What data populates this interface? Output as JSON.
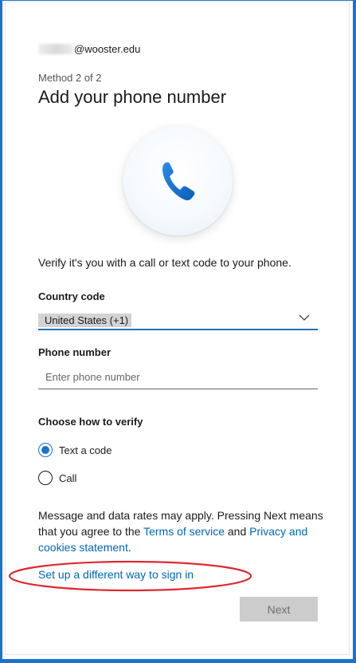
{
  "account": {
    "email_suffix": "@wooster.edu"
  },
  "header": {
    "step": "Method 2 of 2",
    "title": "Add your phone number"
  },
  "description": "Verify it's you with a call or text code to your phone.",
  "country": {
    "label": "Country code",
    "selected": "United States (+1)"
  },
  "phone": {
    "label": "Phone number",
    "placeholder": "Enter phone number",
    "value": ""
  },
  "verify": {
    "label": "Choose how to verify",
    "options": [
      {
        "label": "Text a code",
        "selected": true
      },
      {
        "label": "Call",
        "selected": false
      }
    ]
  },
  "notice": {
    "text_before": "Message and data rates may apply. Pressing Next means that you agree to the ",
    "terms_link": "Terms of service",
    "text_middle": " and ",
    "privacy_link": "Privacy and cookies statement",
    "text_after": "."
  },
  "alt_signin_link": "Set up a different way to sign in",
  "next_button": "Next",
  "colors": {
    "accent": "#1a73d1",
    "link": "#0067b8",
    "annotation_ellipse": "#e0282e",
    "disabled_button": "#cccccc"
  },
  "icons": {
    "phone": "phone-icon",
    "dropdown": "chevron-down-icon"
  }
}
